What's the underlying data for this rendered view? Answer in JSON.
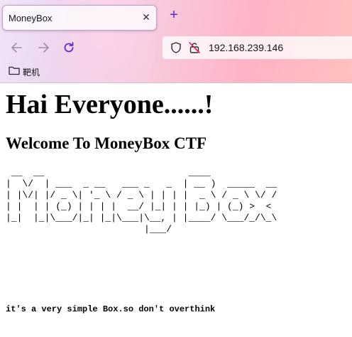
{
  "browser": {
    "tab": {
      "title": "MoneyBox"
    },
    "address_bar": {
      "url": "192.168.239.146"
    },
    "bookmarks": [
      {
        "label": "靶机",
        "icon": "folder-icon"
      }
    ],
    "icons": {
      "tab_close": "close-icon",
      "new_tab": "plus-icon",
      "back": "arrow-left-icon",
      "forward": "arrow-right-icon",
      "reload": "reload-icon",
      "tracking": "shield-icon",
      "insecure": "insecure-lock-icon"
    },
    "accent_color": "#5b2cc9"
  },
  "page": {
    "heading": "Hai Everyone......!",
    "subheading": "Welcome To MoneyBox CTF",
    "ascii_art": " __  __                          ____            \n|  \\/  | ___  _ __   ___ _   _  | __ )  _____  __\n| |\\/| |/ _ \\| '_ \\ / _ \\ | | | |  _ \\ / _ \\ \\/ /\n| |  | | (_) | | | |  __/ |_| | | |_) | (_) >  < \n|_|  |_|\\___/|_| |_|\\___|\\__, | |____/ \\___/_/\\_\\\n                         |___/                    ",
    "note": "it's a very simple Box.so don't overthink"
  }
}
